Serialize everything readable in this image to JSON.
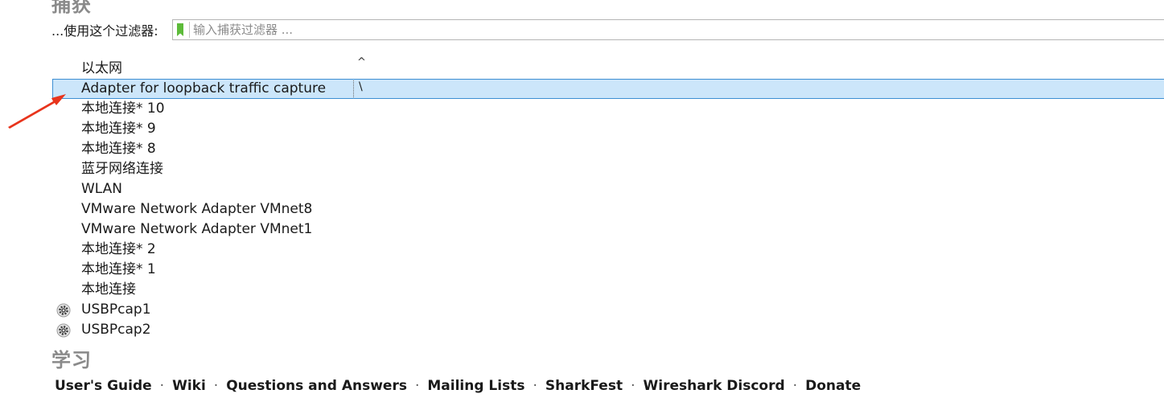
{
  "capture": {
    "heading": "捕获",
    "filter_label": "...使用这个过滤器:",
    "filter_placeholder": "输入捕获过滤器 ...",
    "filter_value": ""
  },
  "list": {
    "sort_indicator": "^",
    "selected_spark": "\\",
    "interfaces": [
      {
        "name": "以太网"
      },
      {
        "name": "Adapter for loopback traffic capture",
        "selected": true
      },
      {
        "name": "本地连接* 10"
      },
      {
        "name": "本地连接* 9"
      },
      {
        "name": "本地连接* 8"
      },
      {
        "name": "蓝牙网络连接"
      },
      {
        "name": "WLAN"
      },
      {
        "name": "VMware Network Adapter VMnet8"
      },
      {
        "name": "VMware Network Adapter VMnet1"
      },
      {
        "name": "本地连接* 2"
      },
      {
        "name": "本地连接* 1"
      },
      {
        "name": "本地连接"
      },
      {
        "name": "USBPcap1",
        "icon": "gear-icon"
      },
      {
        "name": "USBPcap2",
        "icon": "gear-icon"
      }
    ]
  },
  "learn": {
    "heading": "学习",
    "links": [
      "User's Guide",
      "Wiki",
      "Questions and Answers",
      "Mailing Lists",
      "SharkFest",
      "Wireshark Discord",
      "Donate"
    ],
    "separator": "·"
  },
  "colors": {
    "selection_bg": "#cce6fa",
    "selection_border": "#3d8fd3",
    "heading_gray": "#8a8a8a",
    "bookmark_green": "#5dbb3a",
    "annotation_arrow": "#e8341c"
  }
}
